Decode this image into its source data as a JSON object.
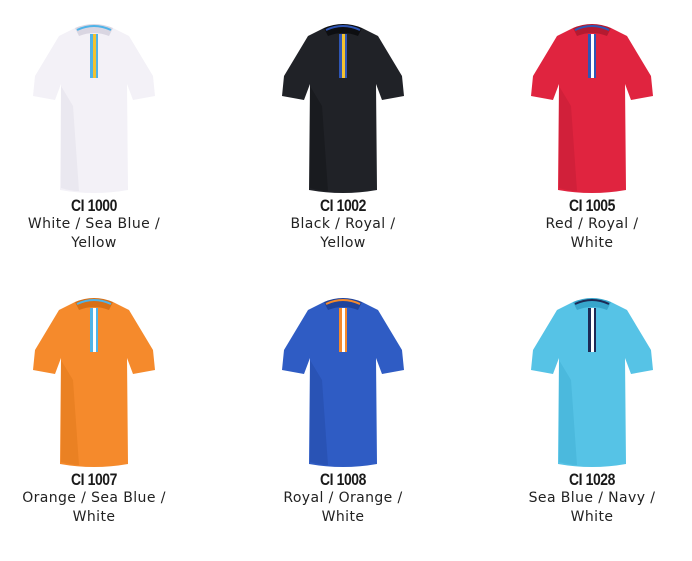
{
  "products": [
    {
      "code": "CI 1000",
      "colors_line1": "White / Sea Blue /",
      "colors_line2": "Yellow",
      "body_color": "#f3f1f7",
      "shade_color": "#d9d6e2",
      "trim": [
        "#4fb3e8",
        "#f2c230",
        "#ffffff"
      ]
    },
    {
      "code": "CI 1002",
      "colors_line1": "Black / Royal /",
      "colors_line2": "Yellow",
      "body_color": "#202227",
      "shade_color": "#0d0e11",
      "trim": [
        "#2f56b5",
        "#f2c230",
        "#ffffff"
      ]
    },
    {
      "code": "CI 1005",
      "colors_line1": "Red / Royal /",
      "colors_line2": "White",
      "body_color": "#e0243f",
      "shade_color": "#b51a30",
      "trim": [
        "#2f56b5",
        "#ffffff",
        "#e0243f"
      ]
    },
    {
      "code": "CI 1007",
      "colors_line1": "Orange / Sea Blue /",
      "colors_line2": "White",
      "body_color": "#f58a2c",
      "shade_color": "#d86f15",
      "trim": [
        "#4fb3e8",
        "#ffffff",
        "#f58a2c"
      ]
    },
    {
      "code": "CI 1008",
      "colors_line1": "Royal / Orange /",
      "colors_line2": "White",
      "body_color": "#2f5cc4",
      "shade_color": "#1f439c",
      "trim": [
        "#f58a2c",
        "#ffffff",
        "#2f5cc4"
      ]
    },
    {
      "code": "CI 1028",
      "colors_line1": "Sea Blue / Navy /",
      "colors_line2": "White",
      "body_color": "#56c3e6",
      "shade_color": "#37a6cc",
      "trim": [
        "#1d2a55",
        "#ffffff",
        "#56c3e6"
      ]
    }
  ]
}
